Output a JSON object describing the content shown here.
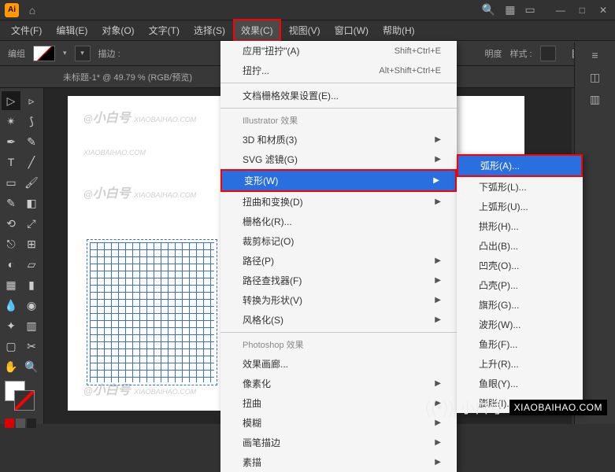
{
  "titlebar": {
    "logo": "Ai"
  },
  "menubar": {
    "items": [
      "文件(F)",
      "编辑(E)",
      "对象(O)",
      "文字(T)",
      "选择(S)",
      "效果(C)",
      "视图(V)",
      "窗口(W)",
      "帮助(H)"
    ]
  },
  "control": {
    "label": "编组",
    "stroke_label": "描边 :",
    "opacity_label": "明度",
    "style_label": "样式 :"
  },
  "tab": "未标题-1* @ 49.79 % (RGB/预览)",
  "effect_menu": {
    "top": [
      {
        "label": "应用\"扭拧\"(A)",
        "shortcut": "Shift+Ctrl+E"
      },
      {
        "label": "扭拧...",
        "shortcut": "Alt+Shift+Ctrl+E"
      },
      {
        "label": "文档栅格效果设置(E)..."
      }
    ],
    "head1": "Illustrator 效果",
    "illustrator": [
      {
        "label": "3D 和材质(3)",
        "sub": true
      },
      {
        "label": "SVG 滤镜(G)",
        "sub": true
      },
      {
        "label": "变形(W)",
        "sub": true,
        "hl": true,
        "boxed": true
      },
      {
        "label": "扭曲和变换(D)",
        "sub": true
      },
      {
        "label": "栅格化(R)..."
      },
      {
        "label": "裁剪标记(O)"
      },
      {
        "label": "路径(P)",
        "sub": true
      },
      {
        "label": "路径查找器(F)",
        "sub": true
      },
      {
        "label": "转换为形状(V)",
        "sub": true
      },
      {
        "label": "风格化(S)",
        "sub": true
      }
    ],
    "head2": "Photoshop 效果",
    "photoshop": [
      {
        "label": "效果画廊..."
      },
      {
        "label": "像素化",
        "sub": true
      },
      {
        "label": "扭曲",
        "sub": true
      },
      {
        "label": "模糊",
        "sub": true
      },
      {
        "label": "画笔描边",
        "sub": true
      },
      {
        "label": "素描",
        "sub": true
      }
    ]
  },
  "submenu": {
    "items": [
      {
        "label": "弧形(A)...",
        "hl": true,
        "boxed": true
      },
      {
        "label": "下弧形(L)..."
      },
      {
        "label": "上弧形(U)..."
      },
      {
        "label": "拱形(H)..."
      },
      {
        "label": "凸出(B)..."
      },
      {
        "label": "凹壳(O)..."
      },
      {
        "label": "凸壳(P)..."
      },
      {
        "label": "旗形(G)..."
      },
      {
        "label": "波形(W)..."
      },
      {
        "label": "鱼形(F)..."
      },
      {
        "label": "上升(R)..."
      },
      {
        "label": "鱼眼(Y)..."
      },
      {
        "label": "膨胀(I)..."
      }
    ]
  },
  "watermark": {
    "cn": "小白号",
    "en": "XIAOBAIHAO.COM"
  },
  "branding": {
    "cn": "小白号",
    "en": "XIAOBAIHAO.COM"
  }
}
